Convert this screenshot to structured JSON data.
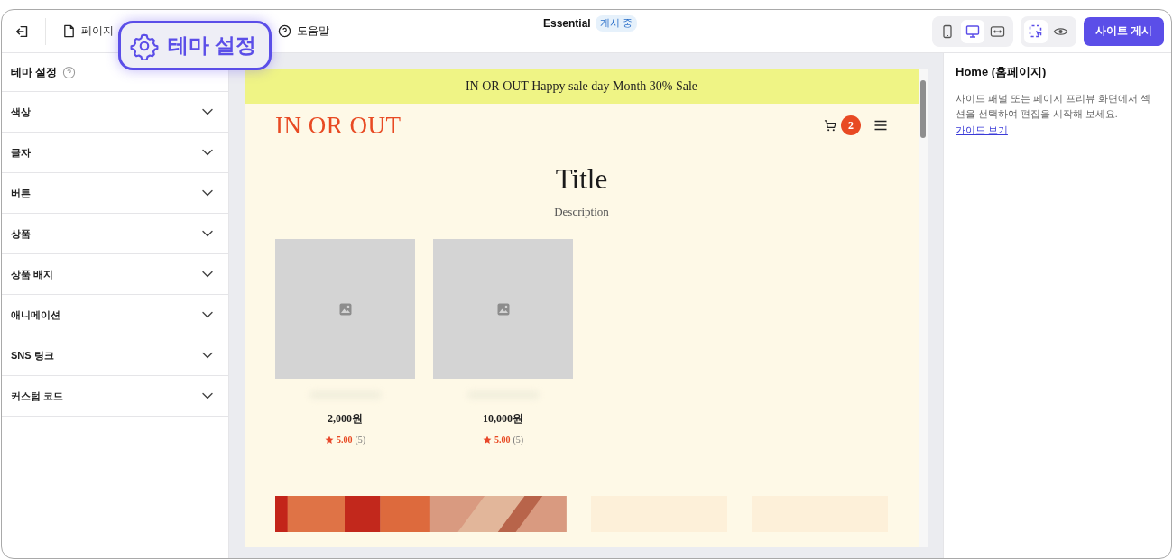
{
  "toolbar": {
    "nav": [
      {
        "label": "페이지"
      },
      {
        "label": "도움말"
      }
    ],
    "site_name": "Essential",
    "status_badge": "게시 중",
    "device_buttons": [
      {
        "kind": "mobile",
        "selected": false
      },
      {
        "kind": "desktop",
        "selected": true
      },
      {
        "kind": "responsive",
        "selected": false
      }
    ],
    "mode_buttons": [
      {
        "kind": "select",
        "selected": true
      },
      {
        "kind": "preview",
        "selected": false
      }
    ],
    "publish_button": "사이트 게시"
  },
  "callout": {
    "label": "테마 설정"
  },
  "sidebar": {
    "title": "테마 설정",
    "sections": [
      {
        "label": "색상",
        "expanded": false
      },
      {
        "label": "글자",
        "expanded": false
      },
      {
        "label": "버튼",
        "expanded": false
      },
      {
        "label": "상품",
        "expanded": false
      },
      {
        "label": "상품 배지",
        "expanded": false
      },
      {
        "label": "애니메이션",
        "expanded": false
      },
      {
        "label": "SNS 링크",
        "expanded": false
      },
      {
        "label": "커스텀 코드",
        "expanded": false
      }
    ]
  },
  "preview": {
    "announcement": "IN OR OUT Happy sale day Month 30% Sale",
    "logo": "IN OR OUT",
    "cart_count": "2",
    "title": "Title",
    "description": "Description",
    "products": [
      {
        "price": "2,000원",
        "rating": "5.00",
        "reviews": "(5)"
      },
      {
        "price": "10,000원",
        "rating": "5.00",
        "reviews": "(5)"
      }
    ]
  },
  "inspector": {
    "title": "Home (홈페이지)",
    "text": "사이드 패널 또는 페이지 프리뷰 화면에서 섹션을 선택하여 편집을 시작해 보세요.",
    "link": "가이드 보기"
  }
}
